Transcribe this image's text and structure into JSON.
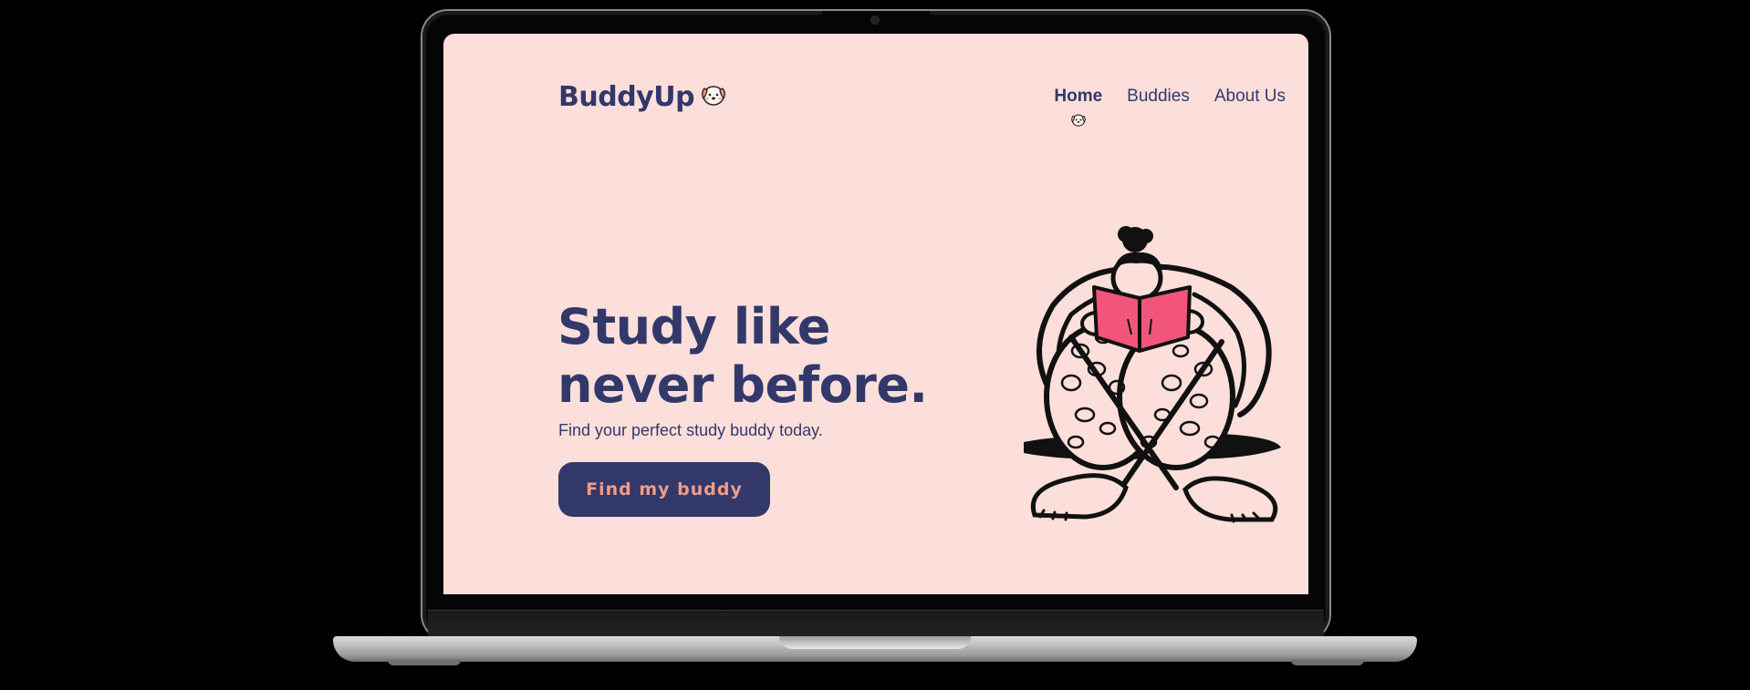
{
  "device": {
    "type": "laptop-mockup"
  },
  "site": {
    "brand_name": "BuddyUp",
    "brand_icon": "dog-face-icon",
    "nav": [
      {
        "label": "Home",
        "active": true
      },
      {
        "label": "Buddies",
        "active": false
      },
      {
        "label": "About Us",
        "active": false
      }
    ],
    "hero": {
      "title_line1": "Study like",
      "title_line2": "never before.",
      "subtitle": "Find your perfect study buddy today.",
      "cta_label": "Find my buddy"
    },
    "illustration": "person-reading-book-illustration",
    "colors": {
      "background": "#fcdfda",
      "primary": "#33386b",
      "accent": "#f29c85",
      "book": "#f2557a"
    }
  }
}
